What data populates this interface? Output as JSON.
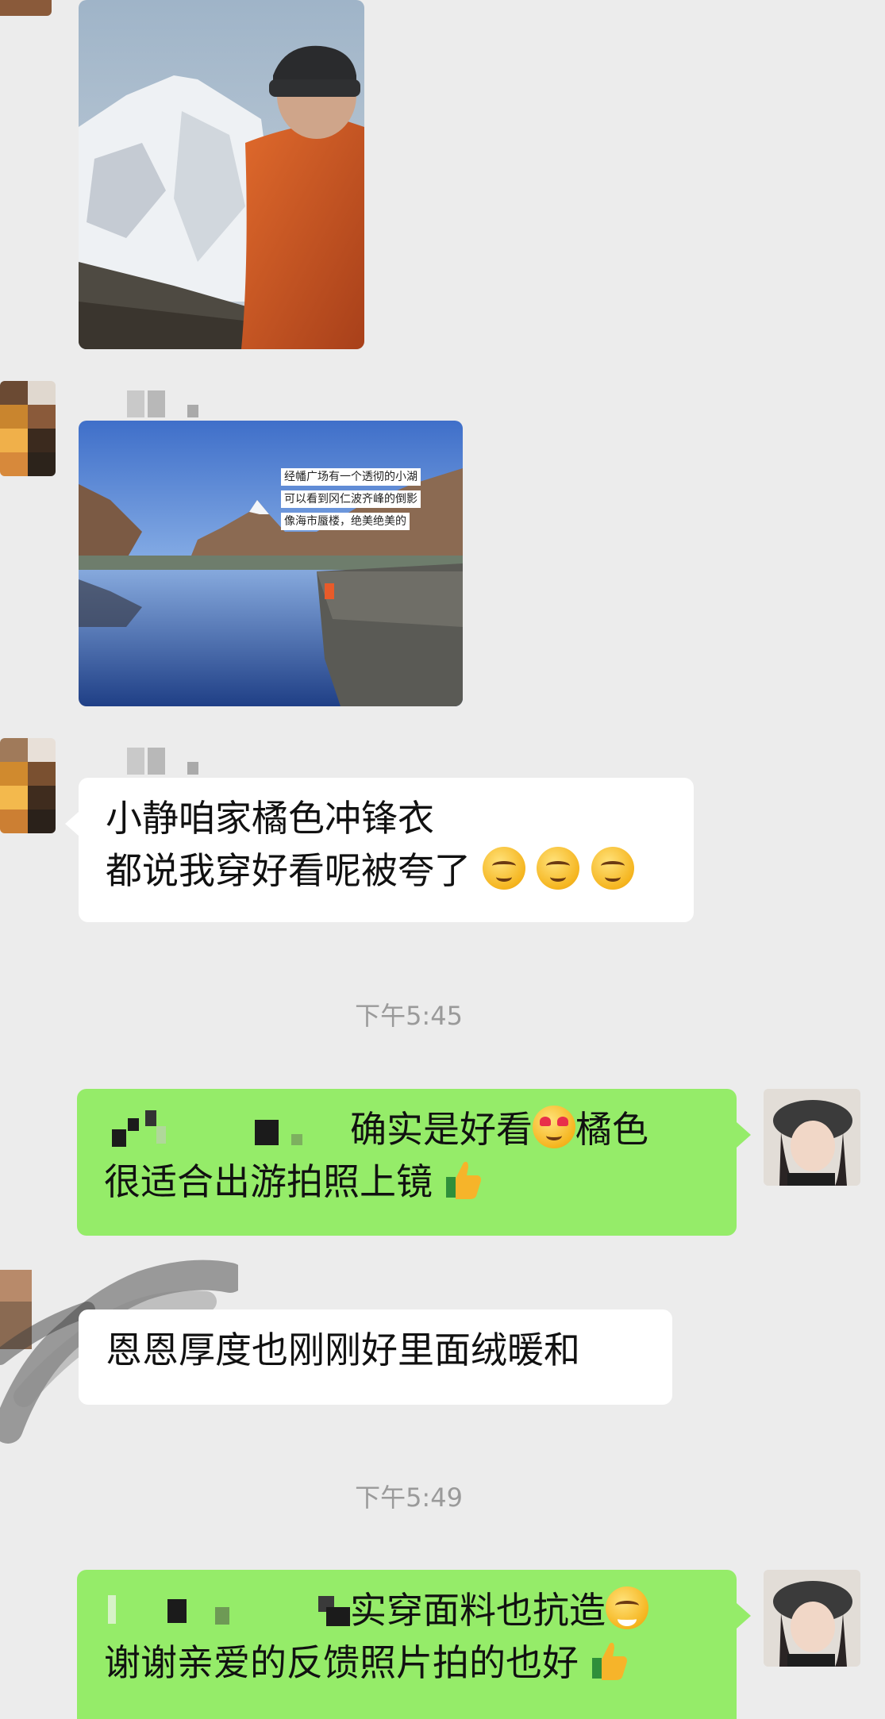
{
  "messages": {
    "m1_text_line1": "小静咱家橘色冲锋衣",
    "m1_text_line2": "都说我穿好看呢被夸了",
    "time1": "下午5:45",
    "m2_text_line1": "确实是好看",
    "m2_text_line1b": "橘色",
    "m2_text_line2": "很适合出游拍照上镜",
    "m3_text": "恩恩厚度也刚刚好里面绒暖和",
    "time2": "下午5:49",
    "m4_text_line1": "实穿面料也抗造",
    "m4_text_line2": "谢谢亲爱的反馈照片拍的也好"
  },
  "photo2_caption_lines": [
    "经幡广场有一个透彻的小湖",
    "可以看到冈仁波齐峰的倒影",
    "像海市蜃楼，绝美绝美的"
  ],
  "colors": {
    "bg": "#ececec",
    "green_bubble": "#95ec69",
    "white_bubble": "#ffffff",
    "timestamp": "#9a9a9a"
  }
}
